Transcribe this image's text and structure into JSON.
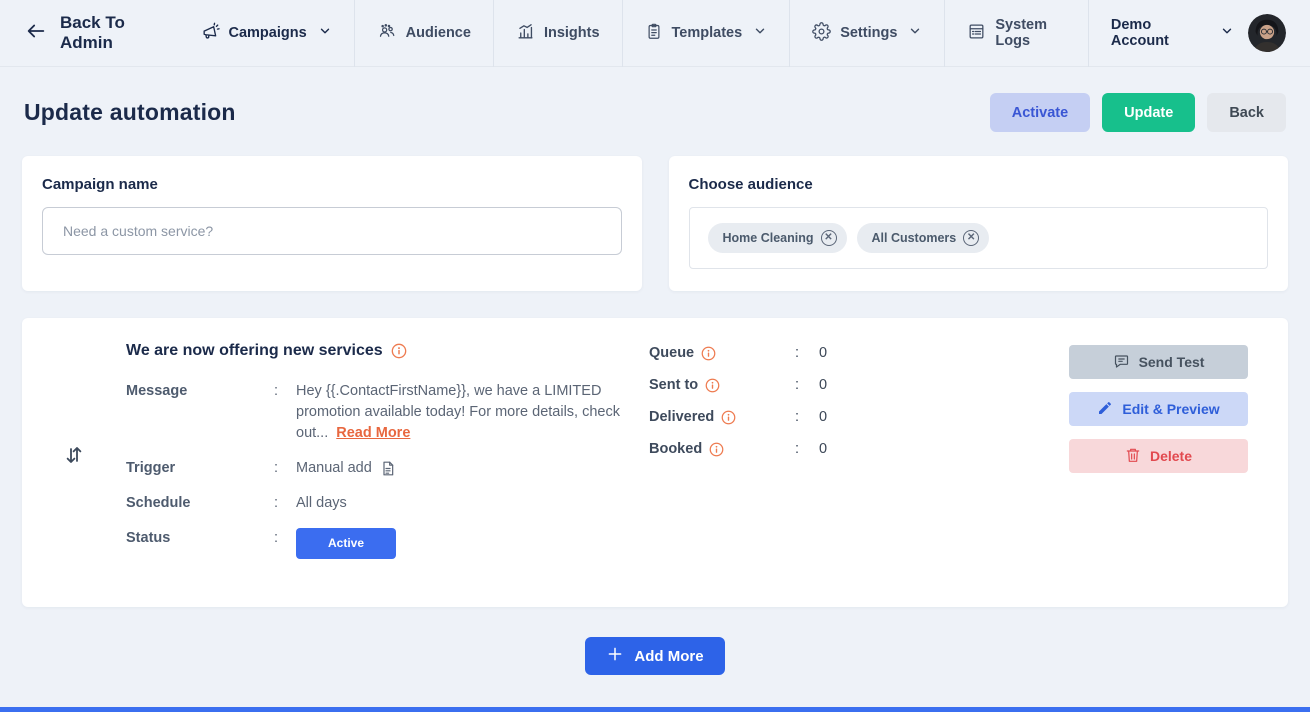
{
  "ui": {
    "colon": ":"
  },
  "nav": {
    "back": {
      "label": "Back To Admin",
      "icon": "arrow-left-icon"
    },
    "items": [
      {
        "label": "Campaigns",
        "icon": "megaphone-icon",
        "chevron": true,
        "active": true
      },
      {
        "label": "Audience",
        "icon": "people-icon"
      },
      {
        "label": "Insights",
        "icon": "bar-chart-icon"
      },
      {
        "label": "Templates",
        "icon": "clipboard-icon",
        "chevron": true
      },
      {
        "label": "Settings",
        "icon": "gear-icon",
        "chevron": true
      },
      {
        "label": "System Logs",
        "icon": "list-icon"
      }
    ],
    "account": {
      "label": "Demo Account",
      "chevron": true,
      "avatar": "user-photo"
    }
  },
  "header": {
    "title": "Update automation",
    "buttons": {
      "activate": "Activate",
      "update": "Update",
      "back": "Back"
    }
  },
  "campaign_name": {
    "title": "Campaign name",
    "value": "",
    "placeholder": "Need a custom service?"
  },
  "audience": {
    "title": "Choose audience",
    "chips": [
      {
        "label": "Home Cleaning"
      },
      {
        "label": "All Customers"
      }
    ]
  },
  "automation": {
    "title": "We are now offering new services",
    "message": {
      "label": "Message",
      "text": "Hey {{.ContactFirstName}}, we have a LIMITED promotion available today! For more details, check out...",
      "link": "Read More"
    },
    "trigger": {
      "label": "Trigger",
      "value": "Manual add",
      "icon": "document-icon"
    },
    "schedule": {
      "label": "Schedule",
      "value": "All days"
    },
    "status": {
      "label": "Status",
      "value": "Active"
    },
    "stats": [
      {
        "label": "Queue",
        "value": "0"
      },
      {
        "label": "Sent to",
        "value": "0"
      },
      {
        "label": "Delivered",
        "value": "0"
      },
      {
        "label": "Booked",
        "value": "0"
      }
    ],
    "actions": {
      "send_test": "Send Test",
      "edit_preview": "Edit & Preview",
      "delete": "Delete"
    }
  },
  "footer": {
    "add_more": "Add More"
  },
  "colors": {
    "background": "#eef2f8",
    "navy_text": "#1b2a4a",
    "primary_blue": "#2d63e8",
    "status_blue": "#3b6df0",
    "green": "#17c08c",
    "orange_info": "#ee7b50",
    "read_more_orange": "#e8673f",
    "delete_red": "#e2494f",
    "footer_blue": "#3b6ff0"
  }
}
